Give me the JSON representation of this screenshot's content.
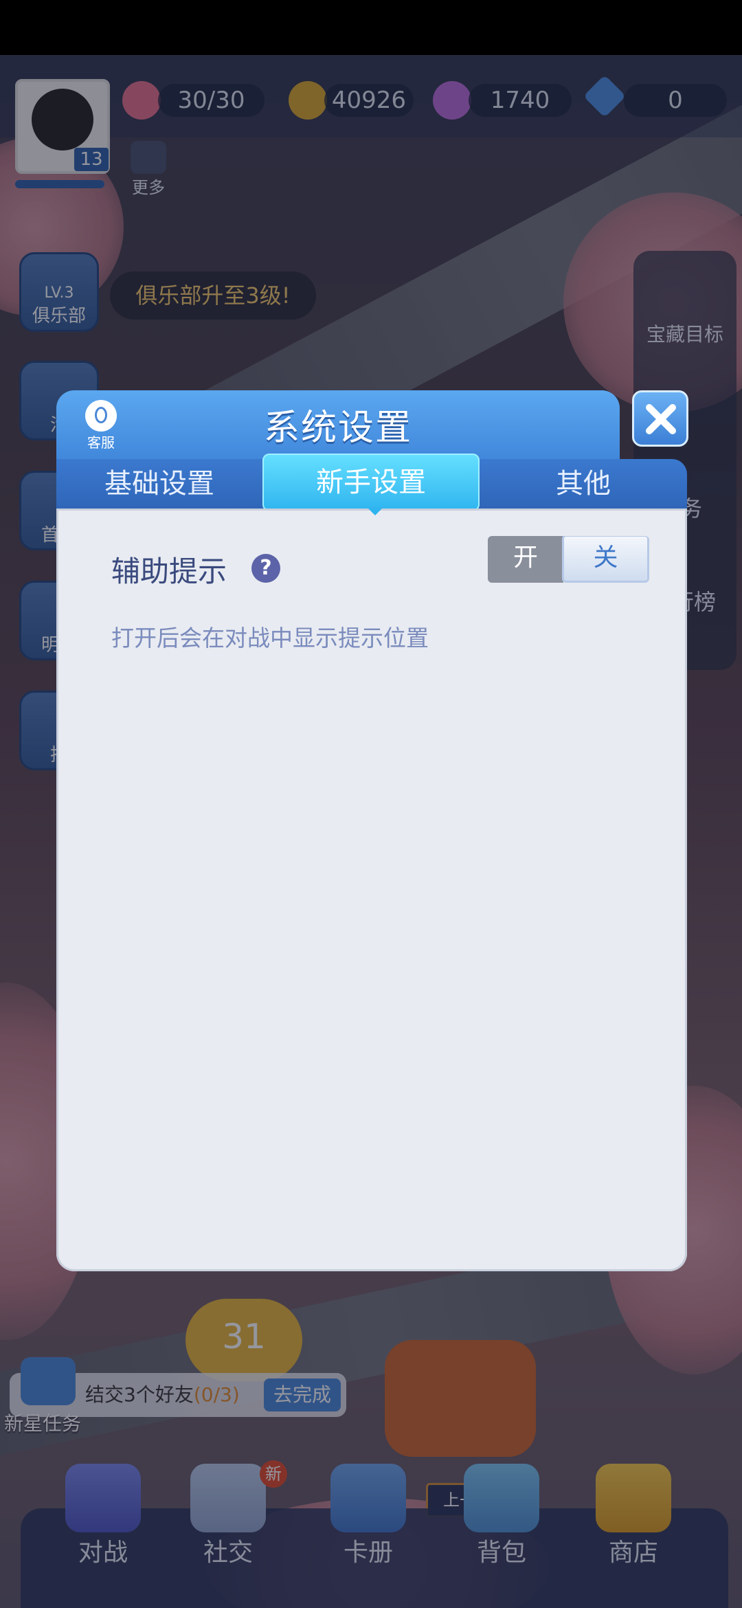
{
  "hud": {
    "lives": "30/30",
    "coins": "40926",
    "gems": "1740",
    "diamonds": "0",
    "level_badge": "13",
    "more_label": "更多"
  },
  "side_left": {
    "club_level": "LV.3",
    "club_label": "俱乐部",
    "club_tooltip": "俱乐部升至3级!",
    "items": [
      "活",
      "首充",
      "明日",
      "扭"
    ]
  },
  "side_right": {
    "treasure_label": "宝藏目标",
    "items": [
      "务",
      "行榜"
    ]
  },
  "mission": {
    "label": "新星任务",
    "text_prefix": "结交3个好友",
    "progress": "(0/3)",
    "go_button": "去完成"
  },
  "map": {
    "stage_number": "31",
    "prev_chapter": "上一章"
  },
  "bottom_nav": {
    "items": [
      {
        "label": "对战",
        "icon": "versus-shield-icon"
      },
      {
        "label": "社交",
        "icon": "chat-bubble-icon",
        "badge": "新"
      },
      {
        "label": "卡册",
        "icon": "card-album-icon"
      },
      {
        "label": "背包",
        "icon": "backpack-icon"
      },
      {
        "label": "商店",
        "icon": "shop-cart-icon"
      }
    ]
  },
  "modal": {
    "title": "系统设置",
    "customer_service_label": "客服",
    "tabs": [
      {
        "label": "基础设置",
        "active": false
      },
      {
        "label": "新手设置",
        "active": true
      },
      {
        "label": "其他",
        "active": false
      }
    ],
    "setting": {
      "label": "辅助提示",
      "description": "打开后会在对战中显示提示位置",
      "toggle_on_label": "开",
      "toggle_off_label": "关",
      "selected": "关"
    }
  },
  "colors": {
    "modal_header": "#4a94e4",
    "active_tab": "#2fb4ef",
    "body_bg": "#e8ebf1",
    "label_text": "#3a4a7e",
    "desc_text": "#7a8bbd"
  }
}
